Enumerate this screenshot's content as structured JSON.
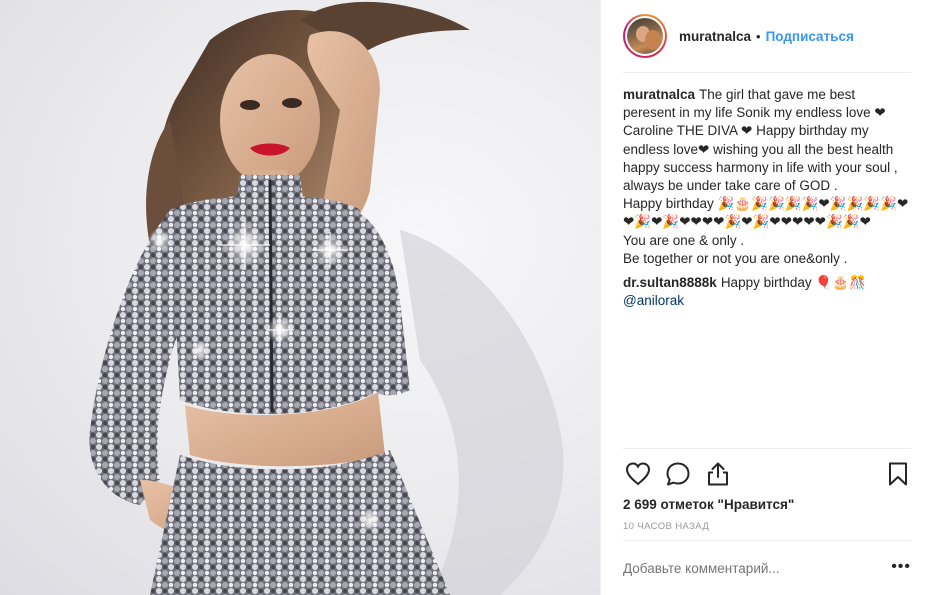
{
  "photo": {
    "alt_icon": "woman-sequin-outfit-photo"
  },
  "header": {
    "username": "muratnalca",
    "separator": "•",
    "follow_label": "Подписаться"
  },
  "caption": {
    "username": "muratnalca",
    "lines": [
      "The girl that gave me best",
      "peresent in my life Sonik my endless love ❤",
      "Caroline THE DIVA ❤ Happy birthday my",
      "endless love❤ wishing you all the best health",
      "happy success harmony in life with your soul ,",
      "always be under take care of GOD .",
      "Happy birthday 🎉🎂🎉🎉🎉🎉❤🎉🎉🎉🎉❤",
      "❤🎉❤🎉❤❤❤❤🎉❤🎉❤❤❤❤❤🎉🎉❤",
      "You are one & only .",
      "Be together or not you are one&only ."
    ]
  },
  "comment": {
    "username": "dr.sultan8888k",
    "text": "Happy birthday 🎈🎂🎊",
    "mention": "@anilorak"
  },
  "actions": {
    "like_icon": "heart-outline-icon",
    "comment_icon": "comment-bubble-icon",
    "share_icon": "share-upload-icon",
    "save_icon": "bookmark-icon"
  },
  "likes": {
    "text": "2 699 отметок \"Нравится\""
  },
  "time": {
    "text": "10 часов назад"
  },
  "add_comment": {
    "placeholder": "Добавьте комментарий...",
    "more_label": "•••"
  },
  "colors": {
    "link_blue": "#3897f0",
    "mention_blue": "#003569",
    "text": "#262626",
    "muted": "#999999",
    "divider": "#efefef"
  }
}
